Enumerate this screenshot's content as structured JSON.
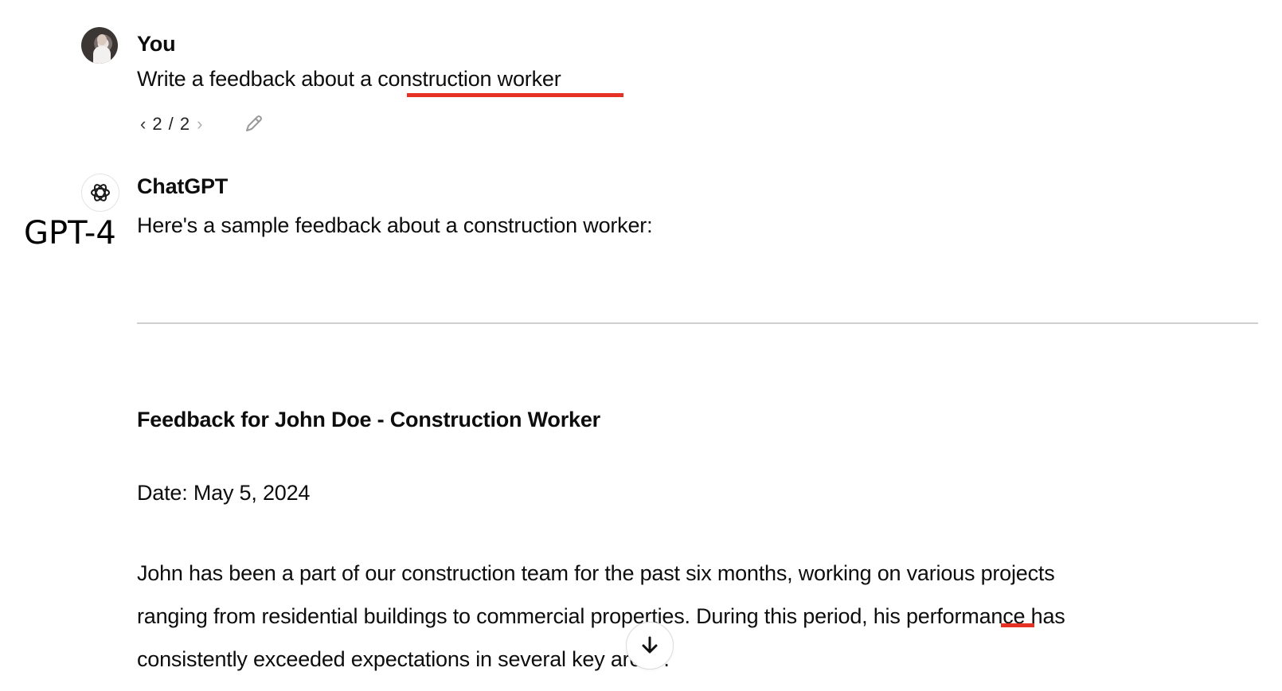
{
  "user": {
    "name": "You",
    "message": "Write a feedback about a construction worker",
    "pager": {
      "prev_icon": "chevron-left-icon",
      "count": "2 / 2",
      "next_icon": "chevron-right-icon"
    },
    "edit_icon": "pencil-icon"
  },
  "assistant": {
    "name": "ChatGPT",
    "model_label": "GPT-4",
    "intro": "Here's a sample feedback about a construction worker:",
    "heading": "Feedback for John Doe - Construction Worker",
    "date": "Date: May 5, 2024",
    "paragraph_lines": [
      "John has been a part of our construction team for the past six months, working on various projects",
      "ranging from residential buildings to commercial properties. During this period, his performance has",
      "consistently exceeded expectations in several key areas."
    ]
  },
  "scroll_button": {
    "icon": "arrow-down-icon"
  },
  "colors": {
    "highlight_underline": "#e53224",
    "text": "#0d0d0d",
    "divider": "#cfcfcf"
  }
}
